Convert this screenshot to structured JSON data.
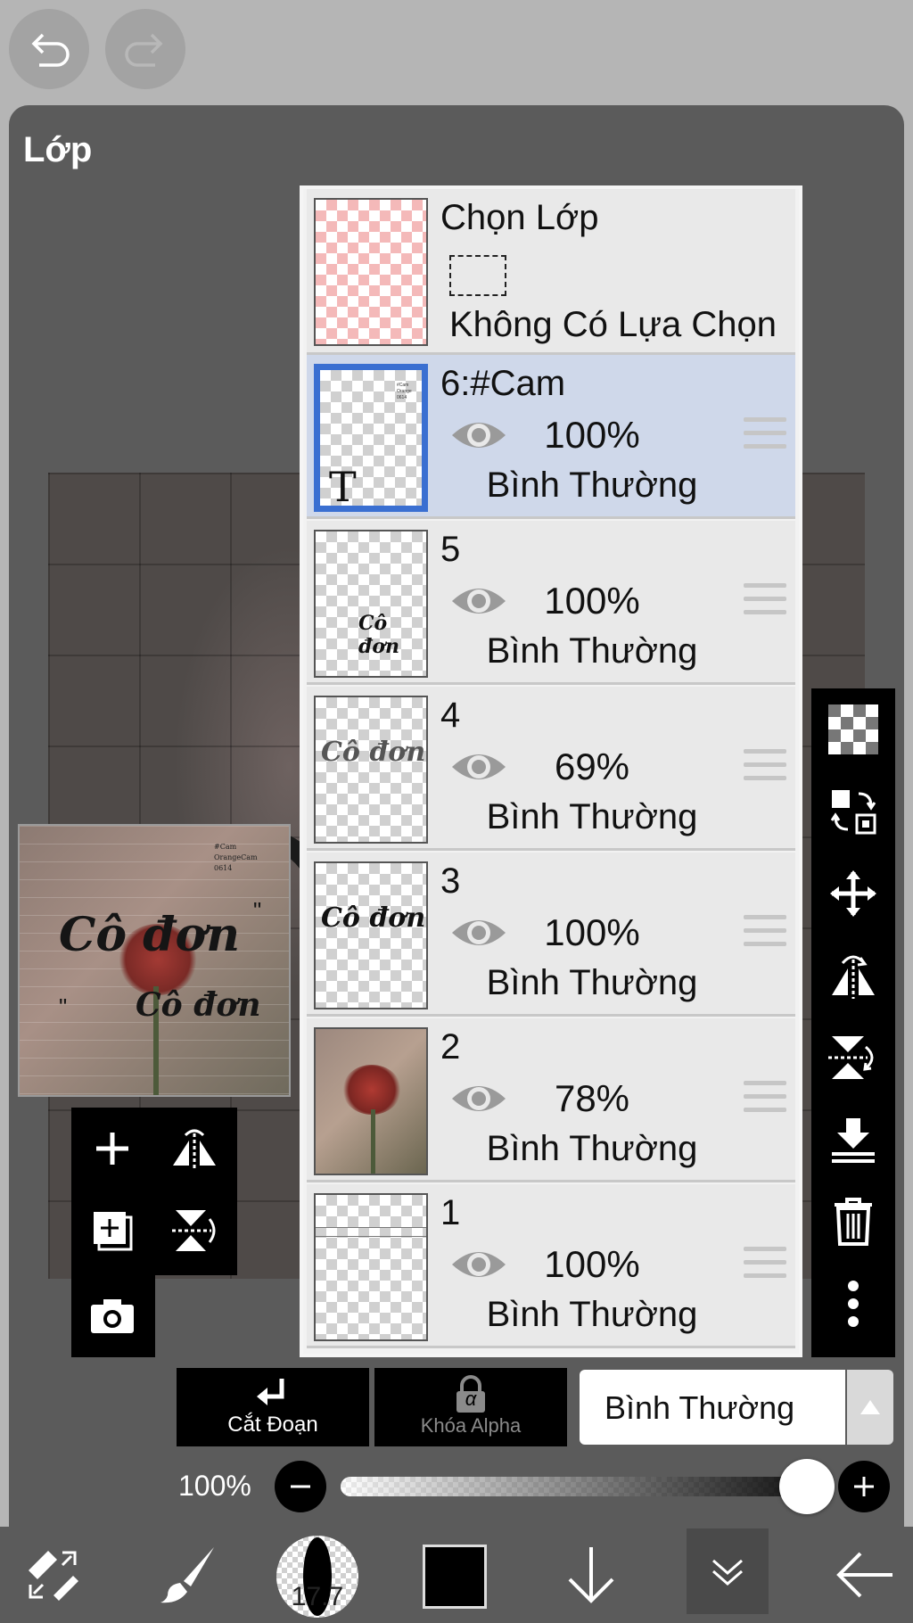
{
  "panel": {
    "title": "Lớp"
  },
  "thumbnail": {
    "text_large": "Cô đơn",
    "text_small": "Cô đơn",
    "deco_left": "\"",
    "deco_right": "\""
  },
  "selection_layer": {
    "title": "Chọn Lớp",
    "subtitle": "Không Có Lựa Chọn"
  },
  "layers": [
    {
      "name": "6:#Cam",
      "opacity": "100%",
      "blend": "Bình Thường",
      "selected": true,
      "thumb_text": "T"
    },
    {
      "name": "5",
      "opacity": "100%",
      "blend": "Bình Thường",
      "selected": false,
      "thumb_text": "Cô đơn"
    },
    {
      "name": "4",
      "opacity": "69%",
      "blend": "Bình Thường",
      "selected": false,
      "thumb_text": "Cô đơn"
    },
    {
      "name": "3",
      "opacity": "100%",
      "blend": "Bình Thường",
      "selected": false,
      "thumb_text": "Cô đơn"
    },
    {
      "name": "2",
      "opacity": "78%",
      "blend": "Bình Thường",
      "selected": false,
      "thumb_text": ""
    },
    {
      "name": "1",
      "opacity": "100%",
      "blend": "Bình Thường",
      "selected": false,
      "thumb_text": ""
    }
  ],
  "bottom_controls": {
    "clip_label": "Cắt Đoạn",
    "alpha_lock_label": "Khóa Alpha",
    "alpha_glyph": "α",
    "blend_mode": "Bình Thường",
    "opacity_label": "100%",
    "opacity_value": 1.0
  },
  "toolbar": {
    "brush_size": "17.7",
    "color": "#000000"
  },
  "icons": [
    "undo-icon",
    "redo-icon",
    "add-layer-icon",
    "flip-horizontal-icon",
    "add-layer-copy-icon",
    "flip-vertical-icon",
    "camera-icon",
    "transparency-icon",
    "layer-swap-icon",
    "move-icon",
    "flip-rotate-icon",
    "flip-vertical-rotate-icon",
    "merge-down-icon",
    "trash-icon",
    "more-icon",
    "transform-icon",
    "brush-icon",
    "arrow-down-icon",
    "layers-icon",
    "back-arrow-icon",
    "eye-icon",
    "drag-handle-icon"
  ]
}
